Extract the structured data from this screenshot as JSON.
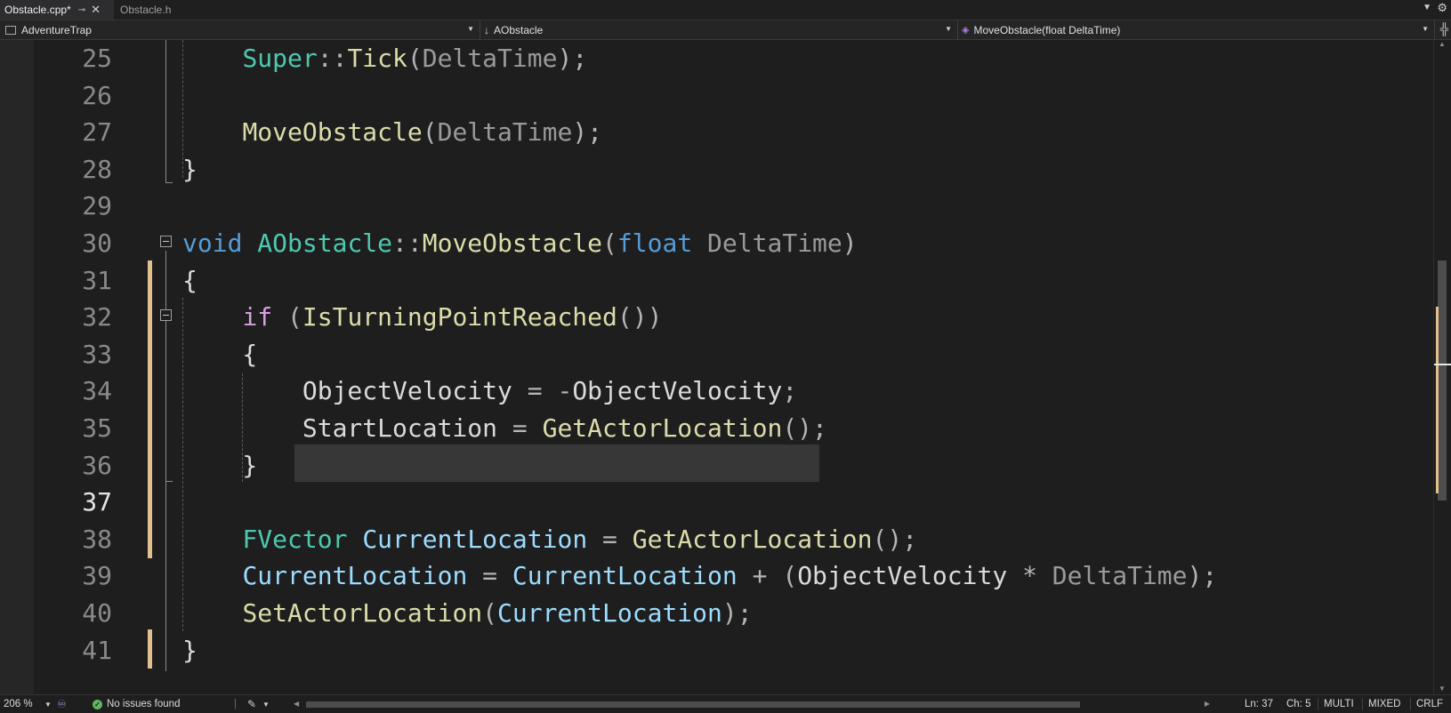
{
  "tabs": [
    {
      "label": "Obstacle.cpp*",
      "active": true,
      "pin_icon": "pin-icon",
      "close_icon": "close-icon"
    },
    {
      "label": "Obstacle.h",
      "active": false
    }
  ],
  "nav": {
    "project": "AdventureTrap",
    "class": "AObstacle",
    "member": "MoveObstacle(float DeltaTime)"
  },
  "editor": {
    "current_line": 37,
    "lines": [
      {
        "n": "25",
        "tokens": [
          [
            "",
            "    "
          ],
          [
            "typ",
            "Super"
          ],
          [
            "op",
            "::"
          ],
          [
            "fn",
            "Tick"
          ],
          [
            "pn",
            "("
          ],
          [
            "prm",
            "DeltaTime"
          ],
          [
            "pn",
            ");"
          ]
        ]
      },
      {
        "n": "26",
        "tokens": []
      },
      {
        "n": "27",
        "tokens": [
          [
            "",
            "    "
          ],
          [
            "fn",
            "MoveObstacle"
          ],
          [
            "pn",
            "("
          ],
          [
            "prm",
            "DeltaTime"
          ],
          [
            "pn",
            ");"
          ]
        ]
      },
      {
        "n": "28",
        "tokens": [
          [
            "",
            "}"
          ]
        ]
      },
      {
        "n": "29",
        "tokens": []
      },
      {
        "n": "30",
        "tokens": [
          [
            "kw",
            "void"
          ],
          [
            "",
            " "
          ],
          [
            "typ",
            "AObstacle"
          ],
          [
            "op",
            "::"
          ],
          [
            "fn",
            "MoveObstacle"
          ],
          [
            "pn",
            "("
          ],
          [
            "kw",
            "float"
          ],
          [
            "",
            " "
          ],
          [
            "prm",
            "DeltaTime"
          ],
          [
            "pn",
            ")"
          ]
        ]
      },
      {
        "n": "31",
        "tokens": [
          [
            "",
            "{"
          ]
        ]
      },
      {
        "n": "32",
        "tokens": [
          [
            "",
            "    "
          ],
          [
            "ctl",
            "if"
          ],
          [
            "",
            " "
          ],
          [
            "pn",
            "("
          ],
          [
            "fn",
            "IsTurningPointReached"
          ],
          [
            "pn",
            "())"
          ]
        ]
      },
      {
        "n": "33",
        "tokens": [
          [
            "",
            "    {"
          ]
        ]
      },
      {
        "n": "34",
        "tokens": [
          [
            "",
            "        "
          ],
          [
            "mem",
            "ObjectVelocity"
          ],
          [
            "",
            " "
          ],
          [
            "op",
            "="
          ],
          [
            "",
            " "
          ],
          [
            "op",
            "-"
          ],
          [
            "mem",
            "ObjectVelocity"
          ],
          [
            "pn",
            ";"
          ]
        ]
      },
      {
        "n": "35",
        "tokens": [
          [
            "",
            "        "
          ],
          [
            "mem",
            "StartLocation"
          ],
          [
            "",
            " "
          ],
          [
            "op",
            "="
          ],
          [
            "",
            " "
          ],
          [
            "fn",
            "GetActorLocation"
          ],
          [
            "pn",
            "();"
          ]
        ]
      },
      {
        "n": "36",
        "tokens": [
          [
            "",
            "    }"
          ]
        ]
      },
      {
        "n": "37",
        "tokens": []
      },
      {
        "n": "38",
        "tokens": [
          [
            "",
            "    "
          ],
          [
            "typ",
            "FVector"
          ],
          [
            "",
            " "
          ],
          [
            "var",
            "CurrentLocation"
          ],
          [
            "",
            " "
          ],
          [
            "op",
            "="
          ],
          [
            "",
            " "
          ],
          [
            "fn",
            "GetActorLocation"
          ],
          [
            "pn",
            "();"
          ]
        ]
      },
      {
        "n": "39",
        "tokens": [
          [
            "",
            "    "
          ],
          [
            "var",
            "CurrentLocation"
          ],
          [
            "",
            " "
          ],
          [
            "op",
            "="
          ],
          [
            "",
            " "
          ],
          [
            "var",
            "CurrentLocation"
          ],
          [
            "",
            " "
          ],
          [
            "op",
            "+"
          ],
          [
            "",
            " "
          ],
          [
            "pn",
            "("
          ],
          [
            "mem",
            "ObjectVelocity"
          ],
          [
            "",
            " "
          ],
          [
            "op",
            "*"
          ],
          [
            "",
            " "
          ],
          [
            "prm",
            "DeltaTime"
          ],
          [
            "pn",
            ");"
          ]
        ]
      },
      {
        "n": "40",
        "tokens": [
          [
            "",
            "    "
          ],
          [
            "fn",
            "SetActorLocation"
          ],
          [
            "pn",
            "("
          ],
          [
            "var",
            "CurrentLocation"
          ],
          [
            "pn",
            ");"
          ]
        ]
      },
      {
        "n": "41",
        "tokens": [
          [
            "",
            "}"
          ]
        ]
      }
    ]
  },
  "status": {
    "zoom": "206 %",
    "issues": "No issues found",
    "line": "Ln: 37",
    "col": "Ch: 5",
    "selection_mode": "MULTI",
    "tabs_mode": "MIXED",
    "line_ending": "CRLF"
  },
  "colors": {
    "keyword": "#569cd6",
    "control": "#d8a0df",
    "type": "#4ec9b0",
    "function": "#dcdcaa",
    "parameter": "#9a9a9a",
    "variable": "#9cdcfe",
    "change_marker": "#e2c08d"
  }
}
